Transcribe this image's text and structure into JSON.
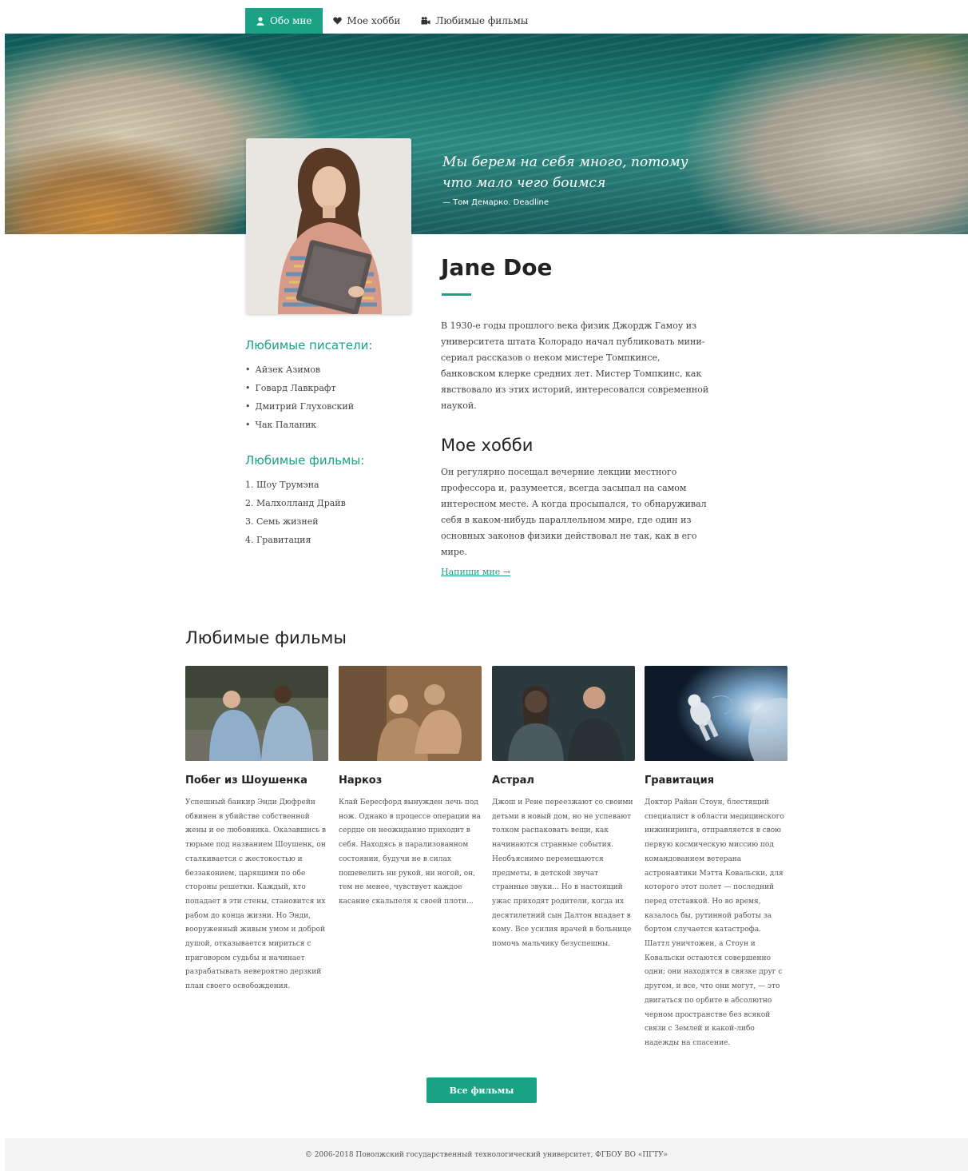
{
  "nav": {
    "items": [
      {
        "label": "Обо мне",
        "icon": "user-icon",
        "active": true
      },
      {
        "label": "Мое хобби",
        "icon": "heart-icon",
        "active": false
      },
      {
        "label": "Любимые фильмы",
        "icon": "video-camera-icon",
        "active": false
      }
    ]
  },
  "hero": {
    "quote": "Мы берем на себя много, потому что мало чего боимся",
    "author": "— Том Демарко. Deadline"
  },
  "profile": {
    "name": "Jane Doe",
    "bio": "В 1930-е годы прошлого века физик Джордж Гамоу из университета штата Колорадо начал публиковать мини-сериал рассказов о неком мистере Томпкинсе, банковском клерке средних лет. Мистер Томпкинс, как явствовало из этих историй, интересовался современной наукой.",
    "hobby_title": "Мое хобби",
    "hobby_text": "Он регулярно посещал вечерние лекции местного профессора и, разумеется, всегда засыпал на самом интересном месте. А когда просыпался, то обнаруживал себя в каком-нибудь параллельном мире, где один из основных законов физики действовал не так, как в его мире.",
    "write_link": "Напиши мне →"
  },
  "sidebar": {
    "writers_title": "Любимые писатели:",
    "writers": [
      "Айзек Азимов",
      "Говард Лавкрафт",
      "Дмитрий Глуховский",
      "Чак Паланик"
    ],
    "films_title": "Любимые фильмы:",
    "films": [
      "1. Шоу Трумэна",
      "2. Малхолланд Драйв",
      "3. Семь жизней",
      "4. Гравитация"
    ]
  },
  "films": {
    "title": "Любимые фильмы",
    "items": [
      {
        "title": "Побег из Шоушенка",
        "desc": "Успешный банкир Энди Дюфрейн обвинен в убийстве собственной жены и ее любовника. Оказавшись в тюрьме под названием Шоушенк, он сталкивается с жестокостью и беззаконием, царящими по обе стороны решетки. Каждый, кто попадает в эти стены, становится их рабом до конца жизни. Но Энди, вооруженный живым умом и доброй душой, отказывается мириться с приговором судьбы и начинает разрабатывать невероятно дерзкий план своего освобождения."
      },
      {
        "title": "Наркоз",
        "desc": "Клай Бересфорд вынужден лечь под нож. Однако в процессе операции на сердце он неожиданно приходит в себя. Находясь в парализованном состоянии, будучи не в силах пошевелить ни рукой, ни ногой, он, тем не менее, чувствует каждое касание скальпеля к своей плоти..."
      },
      {
        "title": "Астрал",
        "desc": "Джош и Рене переезжают со своими детьми в новый дом, но не успевают толком распаковать вещи, как начинаются странные события. Необъяснимо перемещаются предметы, в детской звучат странные звуки... Но в настоящий ужас приходят родители, когда их десятилетний сын Далтон впадает в кому. Все усилия врачей в больнице помочь мальчику безуспешны."
      },
      {
        "title": "Гравитация",
        "desc": "Доктор Райан Стоун, блестящий специалист в области медицинского инжиниринга, отправляется в свою первую космическую миссию под командованием ветерана астронавтики Мэтта Ковальски, для которого этот полет — последний перед отставкой. Но во время, казалось бы, рутинной работы за бортом случается катастрофа. Шаттл уничтожен, а Стоун и Ковальски остаются совершенно одни; они находятся в связке друг с другом, и все, что они могут, — это двигаться по орбите в абсолютно черном пространстве без всякой связи с Землей и какой-либо надежды на спасение."
      }
    ],
    "all_button": "Все фильмы"
  },
  "footer": {
    "text": "© 2006-2018 Поволжский государственный технологический университет, ФГБОУ ВО «ПГТУ»"
  },
  "colors": {
    "accent": "#1aa284"
  }
}
